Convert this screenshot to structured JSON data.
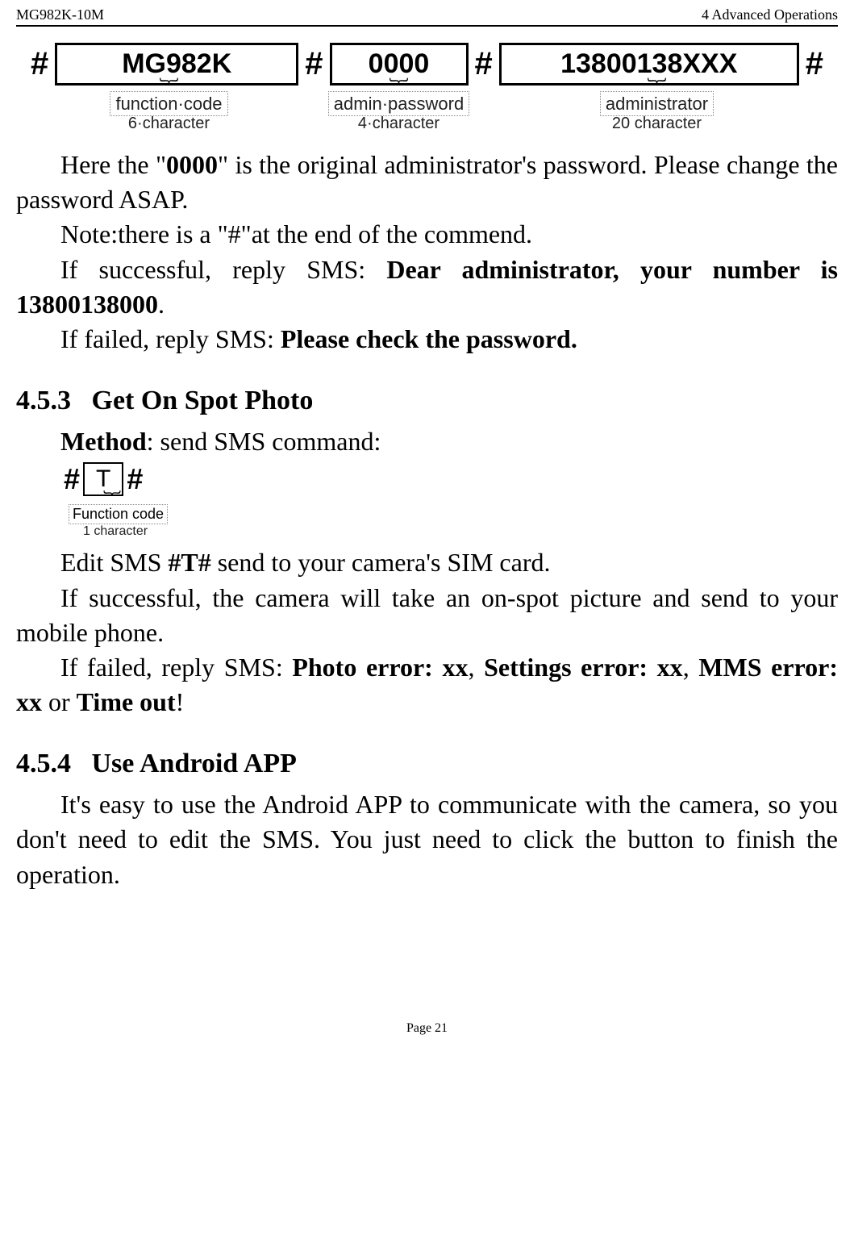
{
  "header": {
    "left": "MG982K-10M",
    "right": "4 Advanced Operations"
  },
  "diagram1": {
    "hash": "#",
    "field1": "MG982K",
    "field2": "0000",
    "field3": "13800138XXX",
    "label1": "function·code",
    "label2": "admin·password",
    "label3": "administrator",
    "count1": "6·character",
    "count2": "4·character",
    "count3": "20 character"
  },
  "para1": {
    "pre": "Here the \"",
    "bold": "0000",
    "post": "\" is the original administrator's password. Please change the password ASAP."
  },
  "para2": "Note:there is a \"#\"at the end of the commend.",
  "para3": {
    "pre": "If successful, reply SMS: ",
    "bold": "Dear administrator, your number is 13800138000",
    "post": "."
  },
  "para4": {
    "pre": "If failed, reply SMS: ",
    "bold": "Please check the password."
  },
  "section453": {
    "num": "4.5.3",
    "title": "Get On Spot Photo"
  },
  "method": {
    "bold": "Method",
    "post": ": send SMS command:"
  },
  "diagram2": {
    "hash": "#",
    "field": "T",
    "label": "Function code",
    "count": "1 character"
  },
  "para5": {
    "pre": "Edit SMS ",
    "bold": "#T#",
    "post": " send to your camera's SIM card."
  },
  "para6": "If successful, the camera will take an on-spot picture and send to your mobile phone.",
  "para7": {
    "pre": "If failed, reply SMS: ",
    "b1": "Photo error: xx",
    "sep1": ", ",
    "b2": "Settings error: xx",
    "sep2": ", ",
    "b3": "MMS error: xx",
    "mid": " or ",
    "b4": "Time out",
    "post": "!"
  },
  "section454": {
    "num": "4.5.4",
    "title": "Use Android APP"
  },
  "para8": "It's easy to use the Android APP to communicate with the camera, so you don't need to edit the SMS.    You just need to click the button to finish the operation.",
  "footer": "Page 21"
}
